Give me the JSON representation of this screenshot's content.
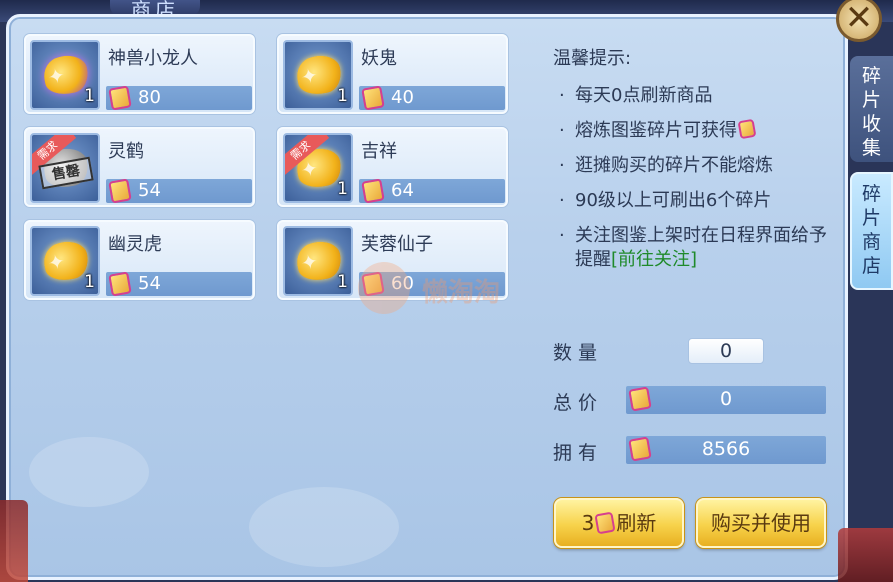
{
  "window": {
    "title": "商店"
  },
  "items": [
    {
      "name": "神兽小龙人",
      "qty": "1",
      "price": "80",
      "style": "purple",
      "ribbon": "",
      "stamp": ""
    },
    {
      "name": "妖鬼",
      "qty": "1",
      "price": "40",
      "style": "gold",
      "ribbon": "",
      "stamp": ""
    },
    {
      "name": "灵鹤",
      "qty": "",
      "price": "54",
      "style": "grey",
      "ribbon": "需求",
      "stamp": "售罄"
    },
    {
      "name": "吉祥",
      "qty": "1",
      "price": "64",
      "style": "gold",
      "ribbon": "需求",
      "stamp": ""
    },
    {
      "name": "幽灵虎",
      "qty": "1",
      "price": "54",
      "style": "gold",
      "ribbon": "",
      "stamp": ""
    },
    {
      "name": "芙蓉仙子",
      "qty": "1",
      "price": "60",
      "style": "gold",
      "ribbon": "",
      "stamp": ""
    }
  ],
  "info": {
    "title": "温馨提示:",
    "tips": [
      "每天0点刷新商品",
      "熔炼图鉴碎片可获得",
      "逛摊购买的碎片不能熔炼",
      "90级以上可刷出6个碎片",
      "关注图鉴上架时在日程界面给予提醒"
    ],
    "link": "[前往关注]"
  },
  "purchase": {
    "qty_label": "数量",
    "qty_value": "0",
    "total_label": "总价",
    "total_value": "0",
    "owned_label": "拥有",
    "owned_value": "8566"
  },
  "buttons": {
    "refresh_count": "3",
    "refresh_label": "刷新",
    "buy_label": "购买并使用"
  },
  "tabs": {
    "collect": "碎片收集",
    "shop": "碎片商店"
  },
  "close_icon": "close-icon",
  "watermark": "懒淘淘",
  "colors": {
    "panel": "#b8d0ec",
    "price_bar": "#7ea7d8",
    "button": "#f7d24a",
    "link": "#1f8a2a"
  }
}
